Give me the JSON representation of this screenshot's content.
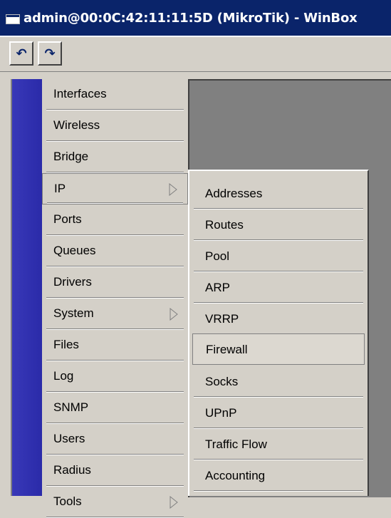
{
  "window": {
    "title": "admin@00:0C:42:11:11:5D (MikroTik) - WinBox"
  },
  "toolbar": {
    "undo_icon": "undo-icon",
    "redo_icon": "redo-icon",
    "undo_glyph": "↶",
    "redo_glyph": "↷"
  },
  "menu": {
    "items": [
      {
        "label": "Interfaces"
      },
      {
        "label": "Wireless"
      },
      {
        "label": "Bridge"
      },
      {
        "label": "IP",
        "submenu": true
      },
      {
        "label": "Ports"
      },
      {
        "label": "Queues"
      },
      {
        "label": "Drivers"
      },
      {
        "label": "System",
        "submenu": true
      },
      {
        "label": "Files"
      },
      {
        "label": "Log"
      },
      {
        "label": "SNMP"
      },
      {
        "label": "Users"
      },
      {
        "label": "Radius"
      },
      {
        "label": "Tools",
        "submenu": true
      }
    ]
  },
  "submenu_ip": {
    "items": [
      {
        "label": "Addresses"
      },
      {
        "label": "Routes"
      },
      {
        "label": "Pool"
      },
      {
        "label": "ARP"
      },
      {
        "label": "VRRP"
      },
      {
        "label": "Firewall"
      },
      {
        "label": "Socks"
      },
      {
        "label": "UPnP"
      },
      {
        "label": "Traffic Flow"
      },
      {
        "label": "Accounting"
      }
    ]
  },
  "colors": {
    "titlebar": "#0a246a",
    "sidebar_accent": "#3333b3",
    "workspace": "#808080",
    "face": "#d4d0c8"
  }
}
